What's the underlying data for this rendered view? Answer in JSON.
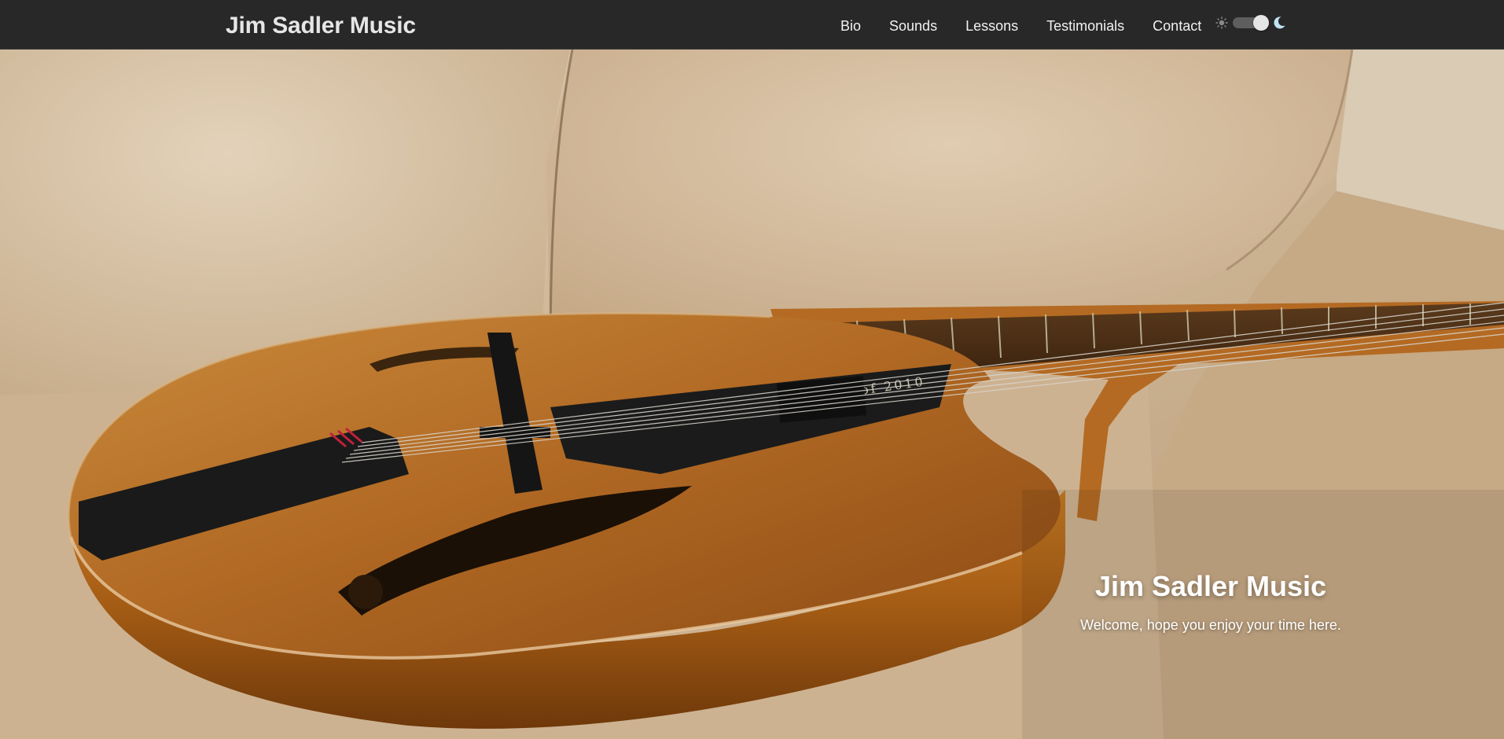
{
  "brand": {
    "title": "Jim Sadler Music"
  },
  "nav": {
    "links": [
      {
        "label": "Bio"
      },
      {
        "label": "Sounds"
      },
      {
        "label": "Lessons"
      },
      {
        "label": "Testimonials"
      },
      {
        "label": "Contact"
      }
    ]
  },
  "theme_toggle": {
    "left_icon": "sun-icon",
    "right_icon": "moon-icon",
    "mode": "dark",
    "colors": {
      "track": "#5e5e5e",
      "knob": "#e6e6e6",
      "moon": "#bfe3f5"
    }
  },
  "hero": {
    "title": "Jim Sadler Music",
    "subtitle": "Welcome, hope you enjoy your time here.",
    "image": {
      "subject": "archtop-guitar-on-couch",
      "engraving": "Class of 2010"
    }
  },
  "colors": {
    "navbar_bg": "#282828",
    "brand_text": "#e6e6e6",
    "nav_text": "#f2f2f2",
    "hero_text": "#ffffff"
  }
}
